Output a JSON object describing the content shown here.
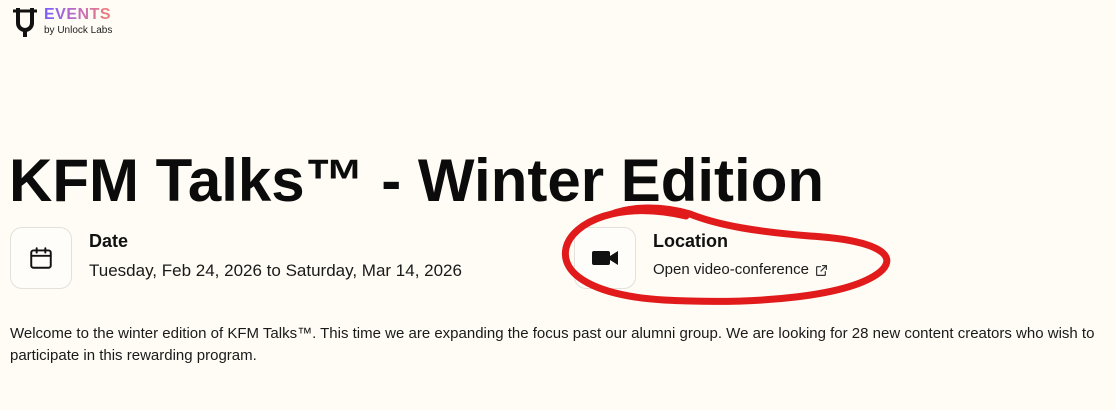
{
  "brand": {
    "name": "EVENTS",
    "byline": "by Unlock Labs"
  },
  "event": {
    "title": "KFM Talks™ - Winter Edition",
    "date": {
      "label": "Date",
      "value": "Tuesday, Feb 24, 2026 to Saturday, Mar 14, 2026",
      "icon": "calendar-icon"
    },
    "location": {
      "label": "Location",
      "link_text": "Open video-conference",
      "icon": "video-camera-icon",
      "link_icon": "external-link-icon"
    },
    "description": "Welcome to the winter edition of KFM Talks™. This time we are expanding the focus past our alumni group. We are looking for 28 new content creators who wish to participate in this rewarding program."
  },
  "colors": {
    "background": "#fffcf5",
    "brand_gradient_start": "#7a5cff",
    "brand_gradient_end": "#f07e72",
    "annotation_red": "#e11b1b"
  }
}
